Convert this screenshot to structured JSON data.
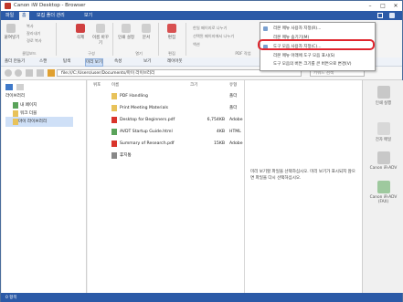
{
  "window": {
    "title": "Canon iW Desktop - Browser"
  },
  "tabs": [
    "파일",
    "홈",
    "모집 폴더 관리",
    "보기"
  ],
  "ribbon": {
    "buttons": [
      "붙여넣기",
      "삭제",
      "이름 바꾸기",
      "인쇄 설정",
      "문서",
      "편집"
    ],
    "small_items": [
      "복사",
      "잘라내기",
      "경로 복사"
    ],
    "pdf_items": [
      "한일 페이지로 나누기",
      "선택된 페이지에서 나누기",
      "액션"
    ],
    "groups": [
      "클립보드",
      "구성",
      "열기",
      "편집",
      "PDF 작업"
    ]
  },
  "menu": {
    "items": [
      "리본 메뉴 사용자 지정(R)...",
      "리본 메뉴 숨기기(M)",
      "도구 모음 사용자 지정(C)...",
      "리본 메뉴 아래에 도구 모음 표시(S)",
      "도구 모음의 버튼 크기를 큰 버튼으로 변경(V)"
    ],
    "highlighted_index": 2,
    "highlight_color": "#e0262e"
  },
  "toolbar": {
    "items": [
      "폴더 만들기",
      "스캔",
      "탐색",
      "미리 보기",
      "속성",
      "보기",
      "레이아웃"
    ],
    "selected_index": 3
  },
  "address": {
    "path": "file:///C:/Users/user/Documents/마이 라이브러리",
    "search_placeholder": "키워드 검색"
  },
  "nav": {
    "header": "라이브러리",
    "items": [
      "내 페이지",
      "워크 더블",
      "마이 라이브러리"
    ],
    "selected_index": 2
  },
  "files": {
    "headers": [
      "위포",
      "이름",
      "크기",
      "유형"
    ],
    "rows": [
      {
        "name": "PDF Handling",
        "size": "",
        "type": "폴더",
        "icon_color": "#e8c25a"
      },
      {
        "name": "Print Meeting Materials",
        "size": "",
        "type": "폴더",
        "icon_color": "#e8c25a"
      },
      {
        "name": "Desktop for Beginners.pdf",
        "size": "6,754KB",
        "type": "Adobe",
        "icon_color": "#d9342b"
      },
      {
        "name": "AVDT Startup Guide.html",
        "size": "4KB",
        "type": "HTML",
        "icon_color": "#5aa35a"
      },
      {
        "name": "Summary of Research.pdf",
        "size": "15KB",
        "type": "Adobe",
        "icon_color": "#d9342b"
      },
      {
        "name": "휴지통",
        "size": "",
        "type": "",
        "icon_color": "#888888"
      }
    ]
  },
  "preview": {
    "message": "미리 보기할 파일을 선택하십시오. 미리 보기가 표시되지 않으면 파일을 다시 선택하십시오."
  },
  "rightbar": {
    "buttons": [
      "인쇄 실행",
      "전자 메일",
      "Canon iR-ADV",
      "Canon iR-ADV (FAX)"
    ]
  },
  "statusbar": {
    "left": "0 항목"
  },
  "colors": {
    "accent": "#2b5aa7",
    "folder": "#e8c25a",
    "pdf": "#d9342b"
  }
}
